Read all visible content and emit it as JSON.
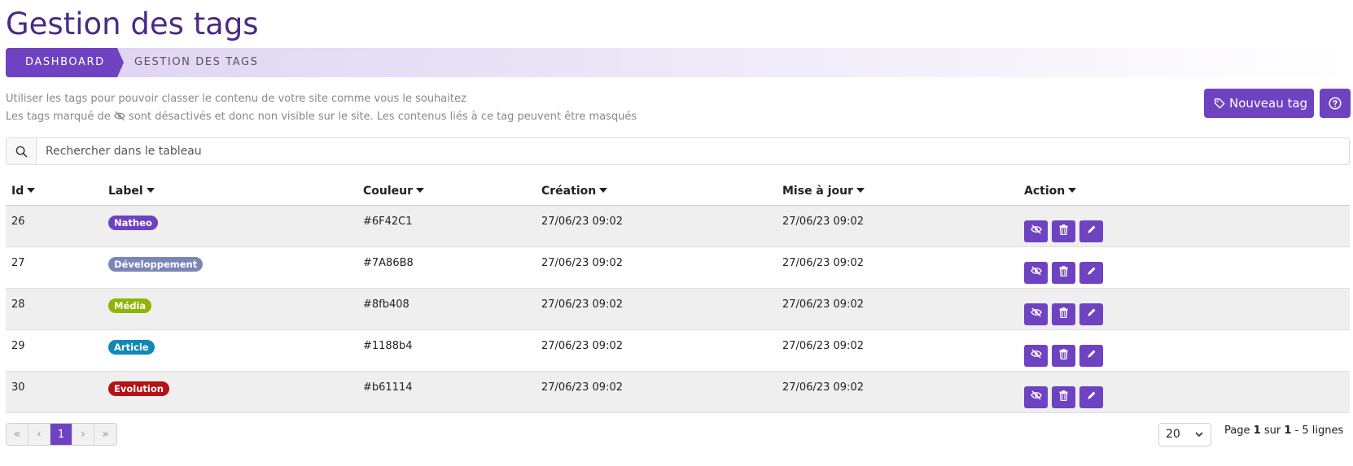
{
  "page": {
    "title": "Gestion des tags"
  },
  "breadcrumb": {
    "dashboard": "DASHBOARD",
    "current": "GESTION DES TAGS"
  },
  "help": {
    "line1": "Utiliser les tags pour pouvoir classer le contenu de votre site comme vous le souhaitez",
    "line2_before": "Les tags marqué de",
    "line2_after": "sont désactivés et donc non visible sur le site. Les contenus liés à ce tag peuvent être masqués"
  },
  "toolbar": {
    "new_tag_label": "Nouveau tag"
  },
  "search": {
    "placeholder": "Rechercher dans le tableau",
    "value": ""
  },
  "table": {
    "columns": [
      "Id",
      "Label",
      "Couleur",
      "Création",
      "Mise à jour",
      "Action"
    ],
    "rows": [
      {
        "id": "26",
        "label": "Natheo",
        "color": "#6F42C1",
        "created": "27/06/23 09:02",
        "updated": "27/06/23 09:02"
      },
      {
        "id": "27",
        "label": "Développement",
        "color": "#7A86B8",
        "created": "27/06/23 09:02",
        "updated": "27/06/23 09:02"
      },
      {
        "id": "28",
        "label": "Média",
        "color": "#8fb408",
        "created": "27/06/23 09:02",
        "updated": "27/06/23 09:02"
      },
      {
        "id": "29",
        "label": "Article",
        "color": "#1188b4",
        "created": "27/06/23 09:02",
        "updated": "27/06/23 09:02"
      },
      {
        "id": "30",
        "label": "Evolution",
        "color": "#b61114",
        "created": "27/06/23 09:02",
        "updated": "27/06/23 09:02"
      }
    ],
    "action_icons": [
      "eye-slash-icon",
      "trash-icon",
      "pencil-icon"
    ]
  },
  "pagination": {
    "first": "«",
    "prev": "‹",
    "current": "1",
    "next": "›",
    "last": "»",
    "per_page": "20",
    "info_page": "Page",
    "info_page_num": "1",
    "info_of": "sur",
    "info_total": "1",
    "info_rows": "- 5 lignes"
  },
  "colors": {
    "accent": "#6f42c1",
    "title": "#4a2a86"
  }
}
